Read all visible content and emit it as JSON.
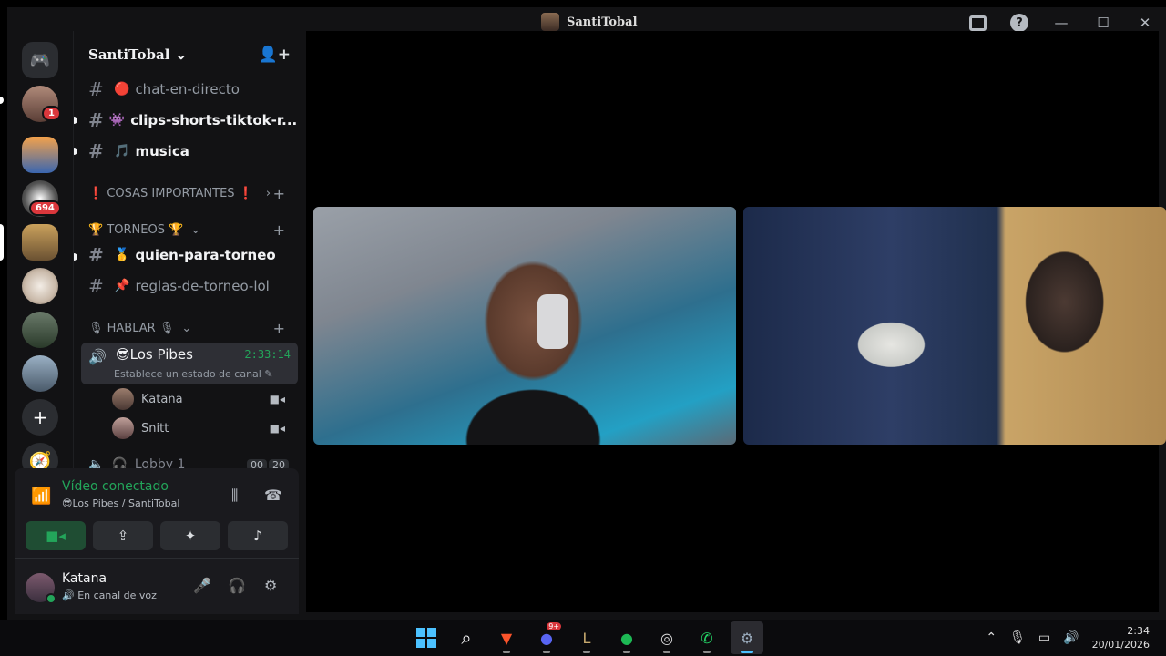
{
  "window": {
    "title": "SantiTobal"
  },
  "server": {
    "name": "SantiTobal"
  },
  "server_list": {
    "badges": {
      "dm": "1",
      "server3": "694"
    }
  },
  "channels": [
    {
      "emoji": "🔴",
      "name": "chat-en-directo",
      "unread": false
    },
    {
      "emoji": "👾",
      "name": "clips-shorts-tiktok-r...",
      "unread": true
    },
    {
      "emoji": "🎵",
      "name": "musica",
      "unread": true
    }
  ],
  "categories": {
    "important": "❗ COSAS IMPORTANTES ❗",
    "torneos": "🏆 TORNEOS 🏆",
    "hablar": "🎙 HABLAR 🎙"
  },
  "torneo_channels": [
    {
      "emoji": "🥇",
      "name": "quien-para-torneo",
      "unread": true
    },
    {
      "emoji": "📌",
      "name": "reglas-de-torneo-lol",
      "unread": false
    }
  ],
  "voice_channel": {
    "emoji": "😎",
    "name": "Los Pibes",
    "timer": "2:33:14",
    "status": "Establece un estado de canal"
  },
  "voice_users": [
    {
      "name": "Katana"
    },
    {
      "name": "Snitt"
    }
  ],
  "lobby": {
    "name": "Lobby 1",
    "count_a": "00",
    "count_b": "20"
  },
  "rtc": {
    "connection": "Vídeo conectado",
    "location": "😎Los Pibes / SantiTobal"
  },
  "user": {
    "name": "Katana",
    "status": "En canal de voz"
  },
  "clock": {
    "time": "2:34",
    "date": "20/01/2026"
  },
  "taskbar_badges": {
    "discord": "9+"
  },
  "colors": {
    "accent_green": "#23a55a",
    "badge_red": "#da373c",
    "windows_blue": "#4cc2ff"
  }
}
